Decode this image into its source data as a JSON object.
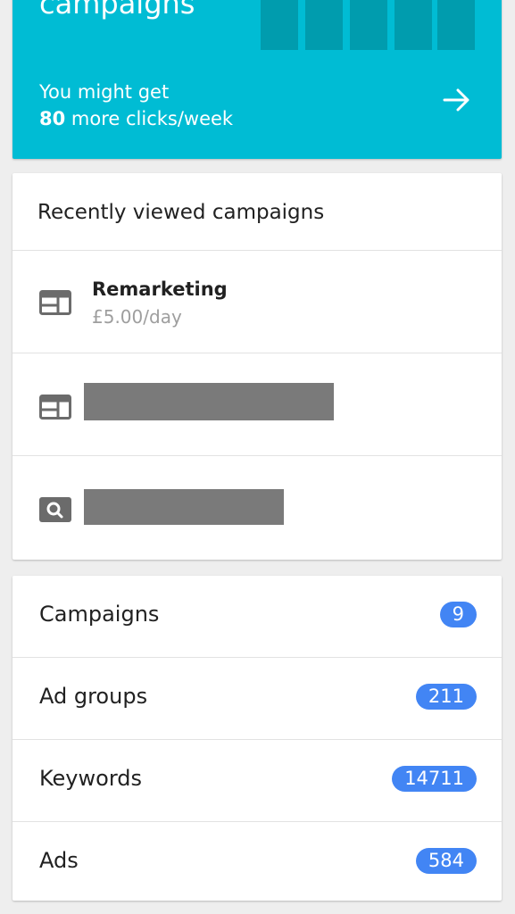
{
  "promo": {
    "title": "campaigns",
    "line1": "You might get",
    "line2_number": "80",
    "line2_text": " more clicks/week",
    "arrow_icon": "arrow-right-icon",
    "color": "#00bcd4"
  },
  "recent": {
    "title": "Recently viewed campaigns",
    "items": [
      {
        "name": "Remarketing",
        "budget": "£5.00/day",
        "icon": "display-campaign-icon"
      },
      {
        "name": "",
        "budget": "",
        "icon": "display-campaign-icon",
        "redacted": true
      },
      {
        "name": "",
        "budget": "",
        "icon": "search-campaign-icon",
        "redacted": true
      }
    ]
  },
  "counts": [
    {
      "label": "Campaigns",
      "value": "9"
    },
    {
      "label": "Ad groups",
      "value": "211"
    },
    {
      "label": "Keywords",
      "value": "14711"
    },
    {
      "label": "Ads",
      "value": "584"
    }
  ],
  "colors": {
    "accent": "#00bcd4",
    "badge": "#4285f4"
  }
}
